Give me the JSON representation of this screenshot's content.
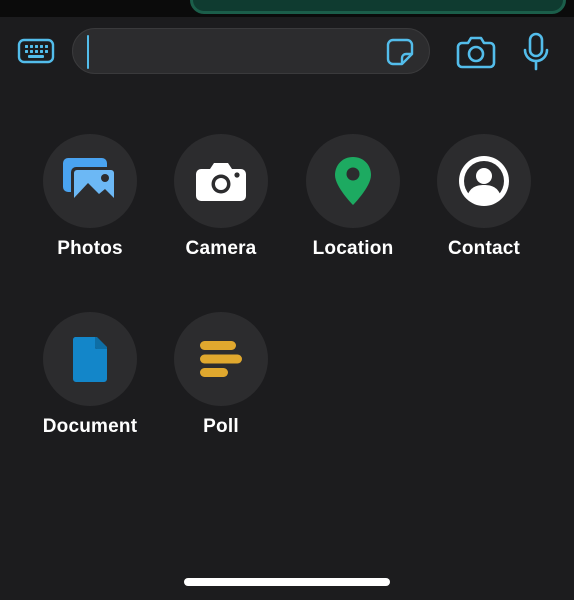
{
  "input_bar": {
    "text_value": "",
    "icons": {
      "keyboard": "keyboard-icon",
      "sticker": "sticker-icon",
      "camera": "camera-icon",
      "mic": "microphone-icon"
    },
    "accent_color": "#53bdeb"
  },
  "attachments": [
    {
      "label": "Photos",
      "icon": "photos-icon",
      "color": "#4aa3f0"
    },
    {
      "label": "Camera",
      "icon": "camera-icon",
      "color": "#ffffff"
    },
    {
      "label": "Location",
      "icon": "location-pin-icon",
      "color": "#1daa61"
    },
    {
      "label": "Contact",
      "icon": "contact-icon",
      "color": "#ffffff"
    },
    {
      "label": "Document",
      "icon": "document-icon",
      "color": "#1386c9"
    },
    {
      "label": "Poll",
      "icon": "poll-icon",
      "color": "#e0a82e"
    }
  ]
}
